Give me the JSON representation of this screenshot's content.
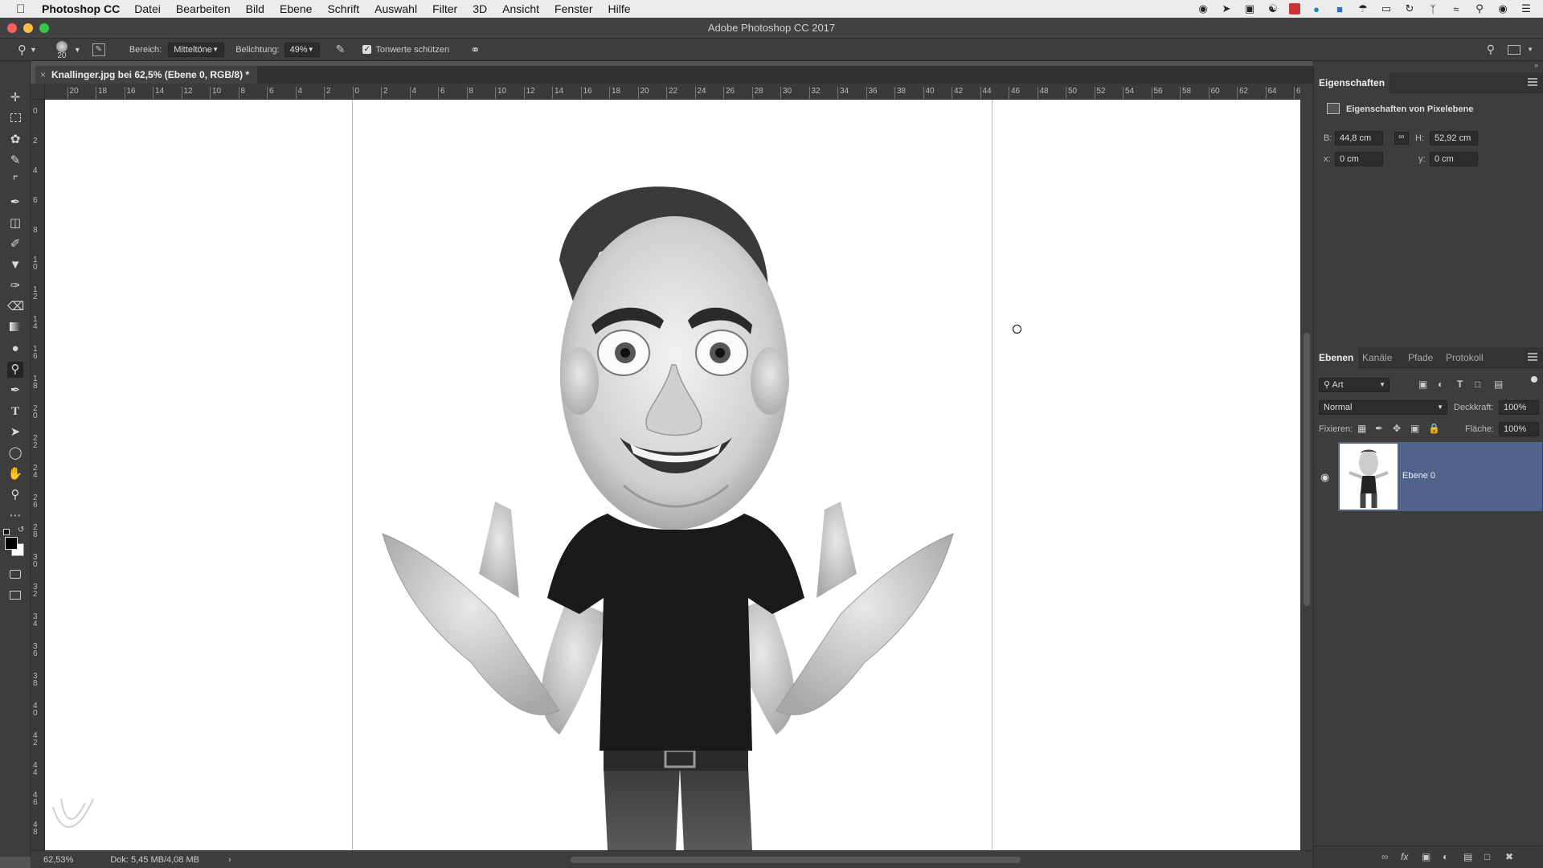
{
  "menubar": {
    "app_name": "Photoshop CC",
    "items": [
      "Datei",
      "Bearbeiten",
      "Bild",
      "Ebene",
      "Schrift",
      "Auswahl",
      "Filter",
      "3D",
      "Ansicht",
      "Fenster",
      "Hilfe"
    ]
  },
  "window": {
    "title": "Adobe Photoshop CC 2017"
  },
  "options": {
    "brush_size": "20",
    "range_label": "Bereich:",
    "range_value": "Mitteltöne",
    "exposure_label": "Belichtung:",
    "exposure_value": "49%",
    "protect_tones_label": "Tonwerte schützen",
    "protect_tones_checked": true
  },
  "document": {
    "tab_title": "Knallinger.jpg bei 62,5% (Ebene 0, RGB/8) *"
  },
  "ruler": {
    "h_labels": [
      "2",
      "20",
      "18",
      "16",
      "14",
      "12",
      "10",
      "8",
      "6",
      "4",
      "2",
      "0",
      "2",
      "4",
      "6",
      "8",
      "10",
      "12",
      "14",
      "16",
      "18",
      "20",
      "22",
      "24",
      "26",
      "28",
      "30",
      "32",
      "34",
      "36",
      "38",
      "40",
      "42",
      "44",
      "46",
      "48",
      "50",
      "52",
      "54",
      "56",
      "58",
      "60",
      "62",
      "64",
      "6"
    ],
    "v_labels": [
      "0",
      "2",
      "4",
      "6",
      "8",
      "1 0",
      "1 2",
      "1 4",
      "1 6",
      "1 8",
      "2 0",
      "2 2",
      "2 4",
      "2 6",
      "2 8",
      "3 0",
      "3 2",
      "3 4",
      "3 6",
      "3 8",
      "4 0",
      "4 2",
      "4 4",
      "4 6",
      "4 8",
      "5"
    ]
  },
  "status": {
    "zoom": "62,53%",
    "doc_info": "Dok: 5,45 MB/4,08 MB",
    "arrow": "›"
  },
  "properties": {
    "title": "Eigenschaften",
    "subtitle": "Eigenschaften von Pixelebene",
    "w_label": "B:",
    "w_value": "44,8 cm",
    "h_label": "H:",
    "h_value": "52,92 cm",
    "x_label": "x:",
    "x_value": "0 cm",
    "y_label": "y:",
    "y_value": "0 cm"
  },
  "layers_panel": {
    "tabs": [
      "Ebenen",
      "Kanäle",
      "Pfade",
      "Protokoll"
    ],
    "filter_value": "Art",
    "blend_mode": "Normal",
    "opacity_label": "Deckkraft:",
    "opacity_value": "100%",
    "lock_label": "Fixieren:",
    "fill_label": "Fläche:",
    "fill_value": "100%",
    "layers": [
      {
        "name": "Ebene 0",
        "visible": true
      }
    ]
  },
  "colors": {
    "accent": "#50638a",
    "ui_dark": "#3d3d3d"
  }
}
